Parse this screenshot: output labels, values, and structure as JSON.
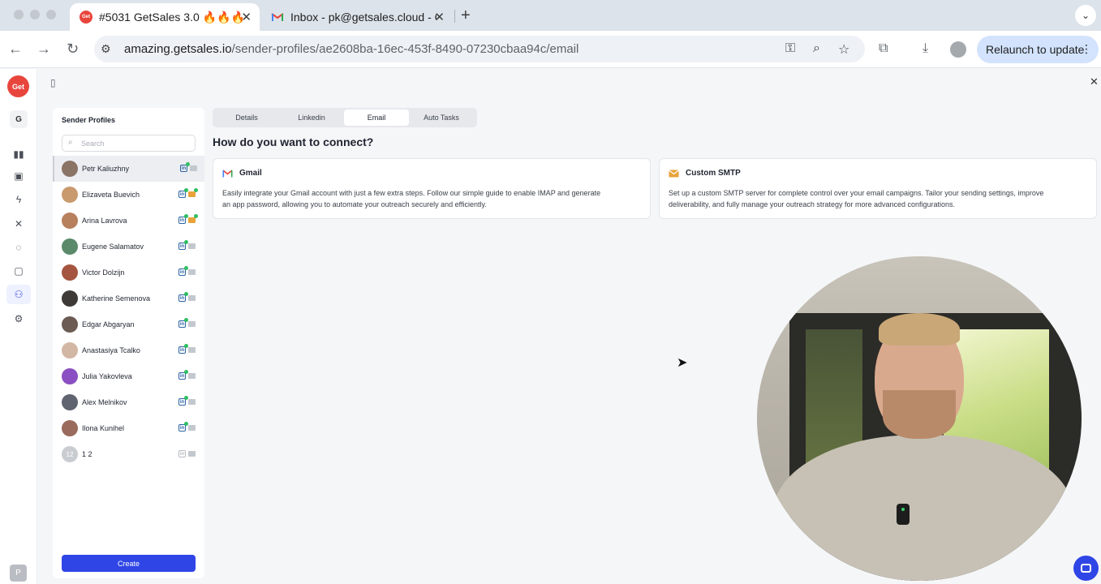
{
  "browser": {
    "tabs": [
      {
        "title": "#5031 GetSales 3.0 🔥🔥🔥",
        "favicon": "Get",
        "active": true
      },
      {
        "title": "Inbox - pk@getsales.cloud - G",
        "favicon": "gmail",
        "active": false
      }
    ],
    "url_host": "amazing.getsales.io",
    "url_path": "/sender-profiles/ae2608ba-16ec-453f-8490-07230cbaa94c/email",
    "relaunch_label": "Relaunch to update",
    "close_glyph": "✕",
    "new_tab_glyph": "+",
    "menu_glyph": "⌄"
  },
  "rail": {
    "logo": "Get",
    "workspace": "G",
    "user": "P"
  },
  "sidebar": {
    "title": "Sender Profiles",
    "search_placeholder": "Search",
    "create_label": "Create",
    "profiles": [
      {
        "name": "Petr Kaliuzhny",
        "color": "#8a7466",
        "linkedin": true,
        "email": false,
        "email_online": false,
        "selected": true
      },
      {
        "name": "Elizaveta Buevich",
        "color": "#c99a6e",
        "linkedin": true,
        "email": true,
        "email_online": true,
        "selected": false
      },
      {
        "name": "Arina Lavrova",
        "color": "#b7815d",
        "linkedin": true,
        "email": true,
        "email_online": true,
        "selected": false
      },
      {
        "name": "Eugene Salamatov",
        "color": "#5b8a6a",
        "linkedin": true,
        "email": false,
        "email_online": false,
        "selected": false
      },
      {
        "name": "Victor Dolzijn",
        "color": "#a5553f",
        "linkedin": true,
        "email": false,
        "email_online": false,
        "selected": false
      },
      {
        "name": "Katherine Semenova",
        "color": "#3d3a38",
        "linkedin": true,
        "email": false,
        "email_online": false,
        "selected": false
      },
      {
        "name": "Edgar Abgaryan",
        "color": "#6c5b52",
        "linkedin": true,
        "email": false,
        "email_online": false,
        "selected": false
      },
      {
        "name": "Anastasiya Tcalko",
        "color": "#d2b7a5",
        "linkedin": true,
        "email": false,
        "email_online": false,
        "selected": false
      },
      {
        "name": "Julia Yakovleva",
        "color": "#8a4fc2",
        "linkedin": true,
        "email": false,
        "email_online": false,
        "selected": false
      },
      {
        "name": "Alex Melnikov",
        "color": "#5f6470",
        "linkedin": true,
        "email": false,
        "email_online": false,
        "selected": false
      },
      {
        "name": "Ilona Kunihel",
        "color": "#9a6a5c",
        "linkedin": true,
        "email": false,
        "email_online": false,
        "selected": false
      },
      {
        "name": "1 2",
        "color": "#c9ccd1",
        "initials": "12",
        "linkedin": false,
        "email": false,
        "email_online": false,
        "selected": false
      }
    ]
  },
  "main": {
    "tabs": [
      "Details",
      "Linkedin",
      "Email",
      "Auto Tasks"
    ],
    "active_tab": "Email",
    "heading": "How do you want to connect?",
    "options": [
      {
        "title": "Gmail",
        "icon": "gmail-icon",
        "description_line1": "Easily integrate your Gmail account with just a few extra steps. Follow our simple guide to enable IMAP and generate",
        "description_line2": "an app password, allowing you to automate your outreach securely and efficiently."
      },
      {
        "title": "Custom SMTP",
        "icon": "envelope-icon",
        "description_line1": "Set up a custom SMTP server for complete control over your email campaigns. Tailor your sending settings, improve",
        "description_line2": "deliverability, and fully manage your outreach strategy for more advanced configurations."
      }
    ]
  },
  "colors": {
    "primary": "#2f45e6",
    "brand_red": "#e8453c",
    "online_green": "#2fbf61",
    "linkedin_blue": "#2b62a3"
  }
}
